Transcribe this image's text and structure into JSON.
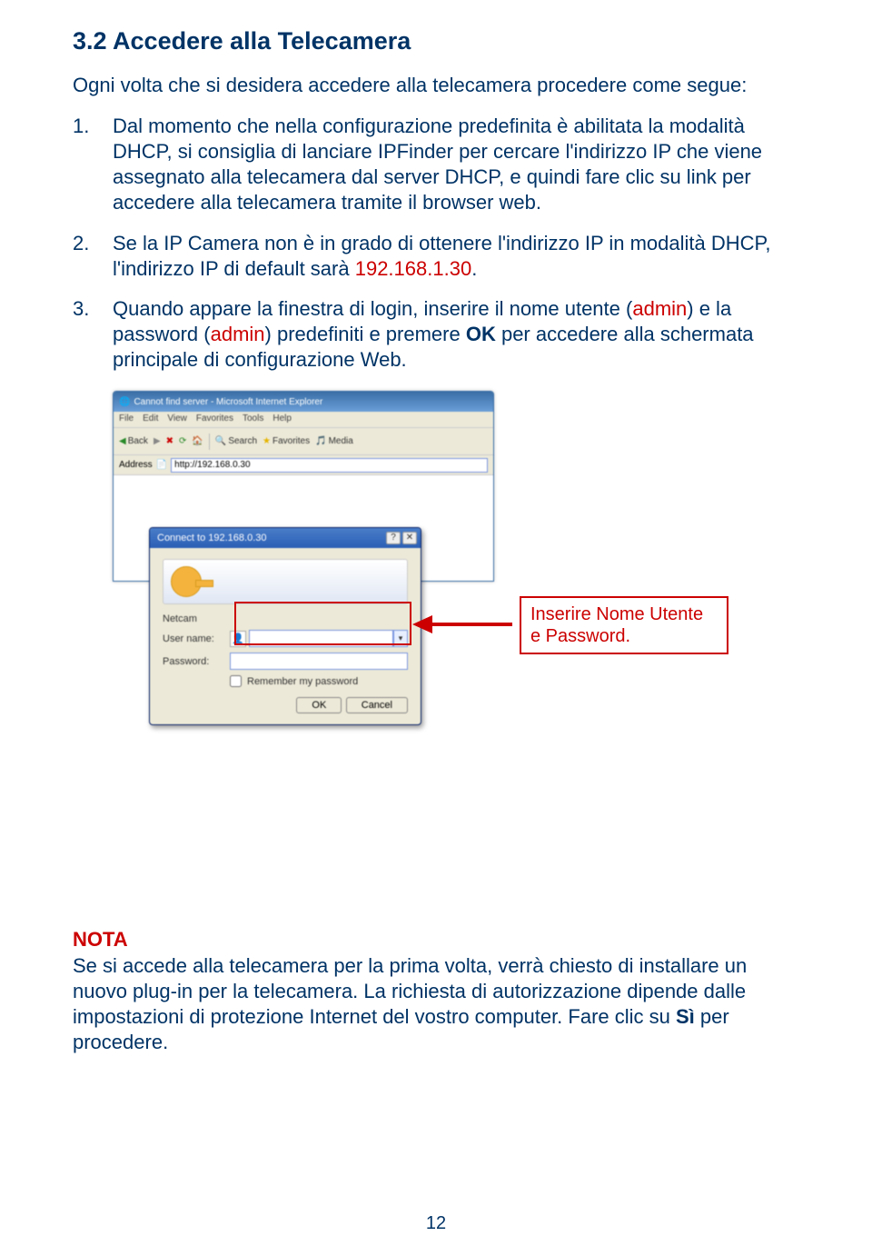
{
  "heading": "3.2 Accedere alla Telecamera",
  "intro": "Ogni volta che si desidera accedere alla telecamera procedere come segue:",
  "steps": {
    "s1": "Dal momento che nella configurazione predefinita è abilitata la modalità DHCP, si consiglia di lanciare IPFinder per cercare l'indirizzo IP che viene assegnato alla telecamera dal server DHCP, e quindi fare clic su link per accedere alla telecamera tramite il browser web.",
    "s2a": "Se la IP Camera non è in grado di ottenere l'indirizzo IP in modalità DHCP, l'indirizzo IP di default sarà ",
    "s2ip": "192.168.1.30",
    "s2b": ".",
    "s3a": "Quando appare la finestra di login, inserire il nome utente (",
    "s3admin1": "admin",
    "s3b": ") e la password (",
    "s3admin2": "admin",
    "s3c": ") predefiniti e premere ",
    "s3ok": "OK",
    "s3d": " per accedere alla schermata principale di configurazione Web."
  },
  "ie": {
    "title": "Cannot find server - Microsoft Internet Explorer",
    "menu": {
      "file": "File",
      "edit": "Edit",
      "view": "View",
      "favorites": "Favorites",
      "tools": "Tools",
      "help": "Help"
    },
    "toolbar": {
      "back": "Back",
      "search": "Search",
      "favorites": "Favorites",
      "media": "Media"
    },
    "addr_label": "Address",
    "addr_value": "http://192.168.0.30"
  },
  "auth": {
    "title": "Connect to 192.168.0.30",
    "realm": "Netcam",
    "user_label": "User name:",
    "pass_label": "Password:",
    "remember": "Remember my password",
    "ok": "OK",
    "cancel": "Cancel"
  },
  "callout": "Inserire Nome Utente e Password.",
  "nota": {
    "title": "NOTA",
    "body_a": "Se si accede alla telecamera per la prima volta, verrà chiesto di installare un nuovo plug-in per la telecamera. La richiesta di autorizzazione dipende dalle impostazioni di protezione Internet del vostro computer. Fare clic su ",
    "body_si": "Sì",
    "body_b": " per procedere."
  },
  "page_number": "12"
}
